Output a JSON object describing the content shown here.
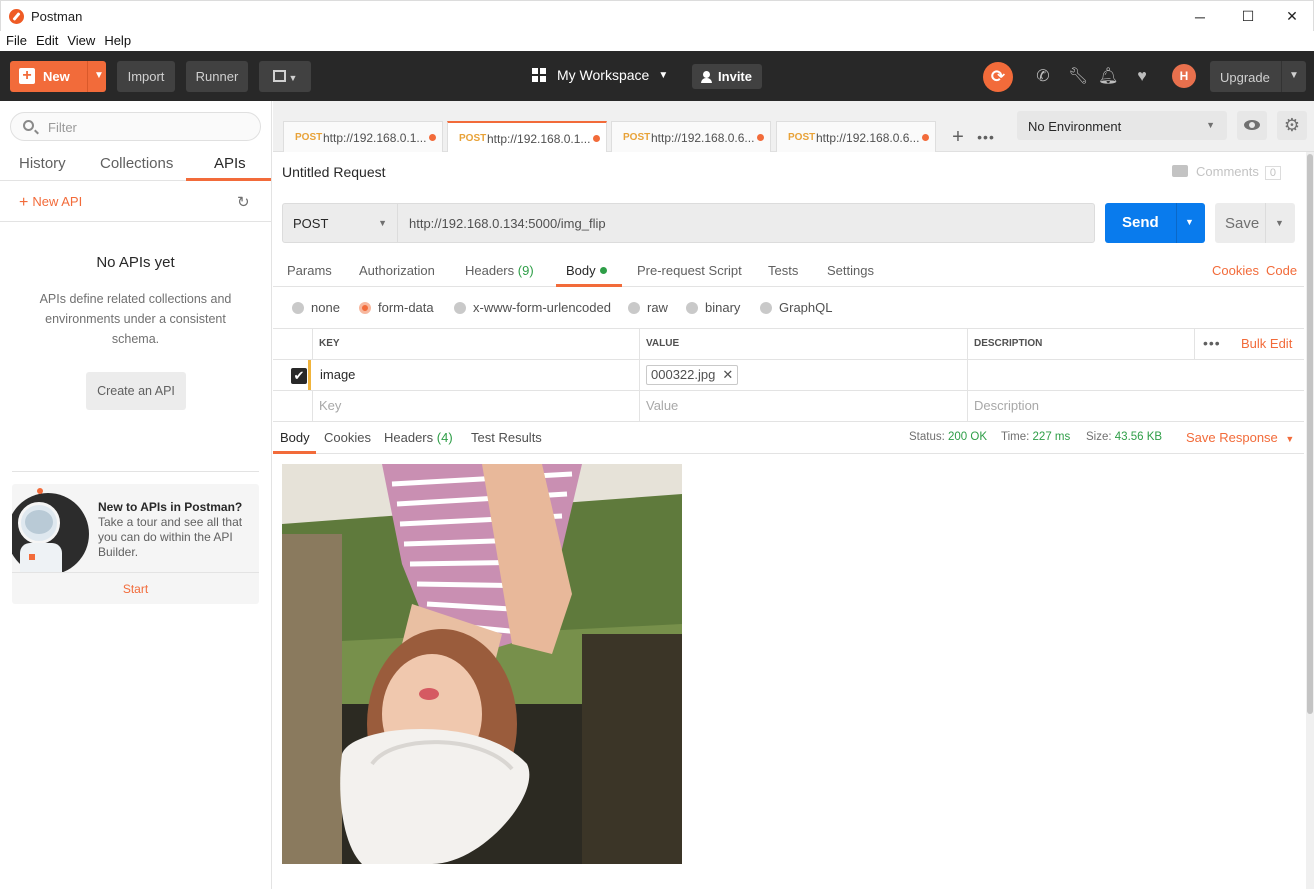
{
  "window": {
    "title": "Postman",
    "minimize": "─",
    "maximize": "☐",
    "close": "✕"
  },
  "menu": [
    "File",
    "Edit",
    "View",
    "Help"
  ],
  "header": {
    "new_label": "New",
    "import_label": "Import",
    "runner_label": "Runner",
    "workspace_label": "My Workspace",
    "invite_label": "Invite",
    "upgrade_label": "Upgrade",
    "accent": "#f26b3a",
    "icons": [
      "sync-icon",
      "satellite-icon",
      "wrench-icon",
      "bell-icon",
      "heart-icon",
      "avatar-icon"
    ]
  },
  "sidebar": {
    "filter_placeholder": "Filter",
    "tabs": [
      "History",
      "Collections",
      "APIs"
    ],
    "active_tab": "APIs",
    "new_api_label": "New API",
    "empty_title": "No APIs yet",
    "empty_desc": "APIs define related collections and environments under a consistent schema.",
    "create_api_label": "Create an API",
    "promo": {
      "title": "New to APIs in Postman?",
      "text": "Take a tour and see all that you can do within the API Builder.",
      "start_label": "Start"
    }
  },
  "request_tabs": [
    {
      "method": "POST",
      "url": "http://192.168.0.1..."
    },
    {
      "method": "POST",
      "url": "http://192.168.0.1..."
    },
    {
      "method": "POST",
      "url": "http://192.168.0.6..."
    },
    {
      "method": "POST",
      "url": "http://192.168.0.6..."
    }
  ],
  "environment": {
    "selected": "No Environment"
  },
  "request": {
    "title": "Untitled Request",
    "comments_label": "Comments",
    "comments_count": "0",
    "method": "POST",
    "url": "http://192.168.0.134:5000/img_flip",
    "send_label": "Send",
    "save_label": "Save",
    "tabs": {
      "params": "Params",
      "authorization": "Authorization",
      "headers": "Headers",
      "headers_count": "(9)",
      "body": "Body",
      "prerequest": "Pre-request Script",
      "tests": "Tests",
      "settings": "Settings"
    },
    "cookies_link": "Cookies",
    "code_link": "Code",
    "body_modes": [
      "none",
      "form-data",
      "x-www-form-urlencoded",
      "raw",
      "binary",
      "GraphQL"
    ],
    "body_mode_selected": "form-data",
    "table": {
      "headers": [
        "KEY",
        "VALUE",
        "DESCRIPTION"
      ],
      "bulk_edit": "Bulk Edit",
      "row": {
        "key": "image",
        "value": "000322.jpg"
      },
      "placeholders": {
        "key": "Key",
        "value": "Value",
        "description": "Description"
      }
    }
  },
  "response": {
    "tabs": {
      "body": "Body",
      "cookies": "Cookies",
      "headers": "Headers",
      "headers_count": "(4)",
      "test_results": "Test Results"
    },
    "status_label": "Status:",
    "status_value": "200 OK",
    "time_label": "Time:",
    "time_value": "227 ms",
    "size_label": "Size:",
    "size_value": "43.56 KB",
    "save_response_label": "Save Response"
  }
}
